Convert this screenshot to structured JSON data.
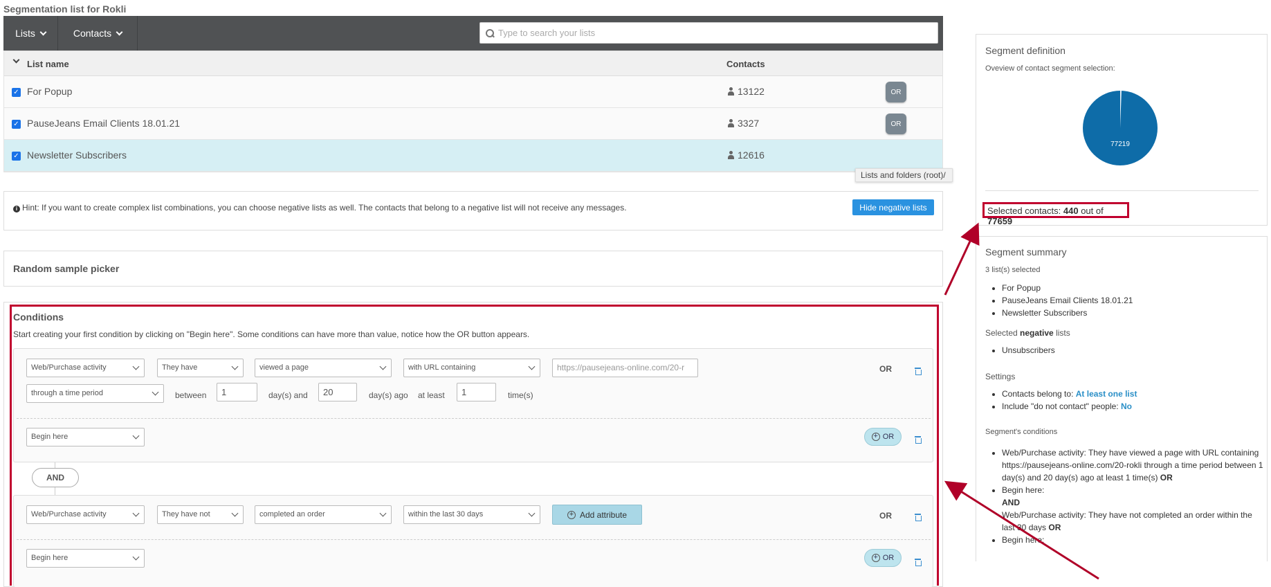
{
  "page_title": "Segmentation list for Rokli",
  "nav": {
    "lists_label": "Lists",
    "contacts_label": "Contacts",
    "search_placeholder": "Type to search your lists"
  },
  "table": {
    "col_name": "List name",
    "col_contacts": "Contacts",
    "rows": [
      {
        "name": "For Popup",
        "count": "13122",
        "badge": "OR"
      },
      {
        "name": "PauseJeans Email Clients 18.01.21",
        "count": "3327",
        "badge": "OR"
      },
      {
        "name": "Newsletter Subscribers",
        "count": "12616"
      }
    ]
  },
  "tooltip": "Lists and folders (root)/",
  "hint": {
    "text": "Hint: If you want to create complex list combinations, you can choose negative lists as well. The contacts that belong to a negative list will not receive any messages.",
    "button": "Hide negative lists"
  },
  "random_sample": "Random sample picker",
  "conditions": {
    "title": "Conditions",
    "desc": "Start creating your first condition by clicking on \"Begin here\". Some conditions can have more than value, notice how the OR button appears.",
    "group1": {
      "activity": "Web/Purchase activity",
      "have": "They have",
      "action": "viewed a page",
      "filter": "with URL containing",
      "url": "https://pausejeans-online.com/20-r",
      "period": "through a time period",
      "between": "between",
      "from": "1",
      "days_and": "day(s) and",
      "to": "20",
      "days_ago": "day(s) ago",
      "at_least": "at least",
      "times_val": "1",
      "times": "time(s)",
      "or_label": "OR",
      "begin": "Begin here",
      "or_pill": "OR"
    },
    "and_label": "AND",
    "group2": {
      "activity": "Web/Purchase activity",
      "have": "They have not",
      "action": "completed an order",
      "filter": "within the last 30 days",
      "add_attr": "Add attribute",
      "or_label": "OR",
      "begin": "Begin here",
      "or_pill": "OR"
    }
  },
  "segment_definition": {
    "title": "Segment definition",
    "subtitle": "Oveview of contact segment selection:",
    "pie_label": "77219",
    "chart_data": {
      "type": "pie",
      "values": [
        77219,
        440
      ],
      "labels": [
        "77219",
        ""
      ]
    },
    "selected_prefix": "Selected contacts:",
    "selected": "440",
    "out_of": "out of",
    "total": "77659",
    "pie_color": "#0e6ca8"
  },
  "segment_summary": {
    "title": "Segment summary",
    "lists_count": "3",
    "lists_selected_text": "list(s) selected",
    "lists": [
      "For Popup",
      "PauseJeans Email Clients 18.01.21",
      "Newsletter Subscribers"
    ],
    "neg_prefix": "Selected",
    "neg_word": "negative",
    "neg_suffix": "lists",
    "neg_lists": [
      "Unsubscribers"
    ],
    "settings_title": "Settings",
    "belong_prefix": "Contacts belong to:",
    "belong_value": "At least one list",
    "dnc_prefix": "Include \"do not contact\" people:",
    "dnc_value": "No",
    "cond_title": "Segment's conditions",
    "cond1": "Web/Purchase activity: They have viewed a page with URL containing https://pausejeans-online.com/20-rokli through a time period between 1 day(s) and 20 day(s) ago at least 1 time(s)",
    "cond1_or": "OR",
    "cond2": "Begin here:",
    "and": "AND",
    "cond3": "Web/Purchase activity: They have not completed an order within the last 30 days",
    "cond3_or": "OR",
    "cond4": "Begin here:"
  }
}
